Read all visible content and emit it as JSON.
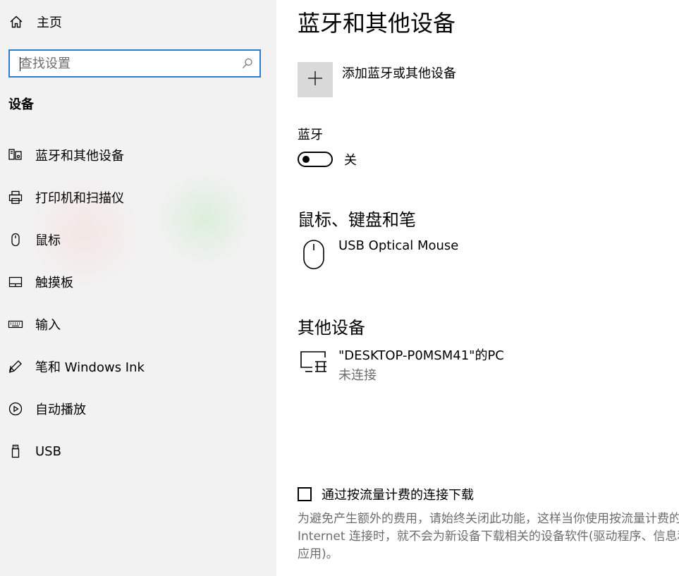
{
  "sidebar": {
    "home_label": "主页",
    "search_placeholder": "查找设置",
    "section_title": "设备",
    "items": [
      {
        "label": "蓝牙和其他设备",
        "icon": "bluetooth-devices-icon"
      },
      {
        "label": "打印机和扫描仪",
        "icon": "printer-icon"
      },
      {
        "label": "鼠标",
        "icon": "mouse-icon"
      },
      {
        "label": "触摸板",
        "icon": "touchpad-icon"
      },
      {
        "label": "输入",
        "icon": "keyboard-icon"
      },
      {
        "label": "笔和 Windows Ink",
        "icon": "pen-icon"
      },
      {
        "label": "自动播放",
        "icon": "autoplay-icon"
      },
      {
        "label": "USB",
        "icon": "usb-icon"
      }
    ]
  },
  "main": {
    "title": "蓝牙和其他设备",
    "add_device_label": "添加蓝牙或其他设备",
    "bluetooth": {
      "label": "蓝牙",
      "state_label": "关",
      "on": false
    },
    "mouse_section": {
      "heading": "鼠标、键盘和笔",
      "devices": [
        {
          "name": "USB Optical Mouse",
          "icon": "mouse-icon"
        }
      ]
    },
    "other_section": {
      "heading": "其他设备",
      "devices": [
        {
          "name": "\"DESKTOP-P0MSM41\"的PC",
          "status": "未连接",
          "icon": "pc-wireless-icon"
        }
      ]
    },
    "metered": {
      "label": "通过按流量计费的连接下载",
      "checked": false,
      "description": "为避免产生额外的费用，请始终关闭此功能，这样当你使用按流量计费的 Internet 连接时，就不会为新设备下载相关的设备软件(驱动程序、信息和应用)。"
    }
  },
  "colors": {
    "accent": "#2b7cd3",
    "sidebar_bg": "#f2f2f2",
    "secondary_text": "#6d6d6d",
    "tile_bg": "#d9d9d9"
  }
}
